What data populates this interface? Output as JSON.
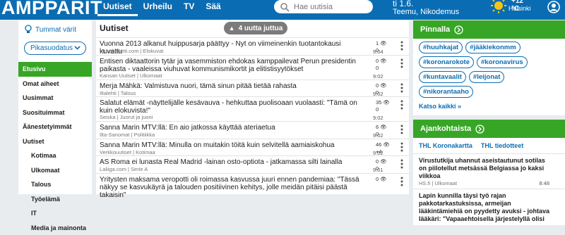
{
  "header": {
    "logo": "AMPPARIT",
    "nav": [
      "Uutiset",
      "Urheilu",
      "TV",
      "Sää"
    ],
    "search_placeholder": "Hae uutisia",
    "date": "ti 1.6.",
    "names": "Teemu, Nikodemus",
    "temp": "+12 °C",
    "city": "Helsinki"
  },
  "sidebar": {
    "tips": "Tummat värit",
    "quick_filter": "Pikasuodatus",
    "items": [
      {
        "label": "Etusivu",
        "active": true,
        "sub": false
      },
      {
        "label": "Omat aiheet",
        "active": false,
        "sub": false
      },
      {
        "label": "Uusimmat",
        "active": false,
        "sub": false
      },
      {
        "label": "Suosituimmat",
        "active": false,
        "sub": false
      },
      {
        "label": "Äänestetyimmät",
        "active": false,
        "sub": false
      },
      {
        "label": "Uutiset",
        "active": false,
        "sub": false
      },
      {
        "label": "Kotimaa",
        "active": false,
        "sub": true
      },
      {
        "label": "Ulkomaat",
        "active": false,
        "sub": true
      },
      {
        "label": "Talous",
        "active": false,
        "sub": true
      },
      {
        "label": "Työelämä",
        "active": false,
        "sub": true
      },
      {
        "label": "IT",
        "active": false,
        "sub": true
      },
      {
        "label": "Media ja mainonta",
        "active": false,
        "sub": true
      }
    ]
  },
  "main": {
    "title": "Uutiset",
    "new_items": "4 uutta juttua",
    "articles": [
      {
        "title": "Vuonna 2013 alkanut huippusarja päättyy - Nyt on viimeinenkin tuotantokausi kuvattu",
        "source": "Muropaketti.com | Elokuvat",
        "time": "9:04",
        "c1": "1",
        "c2": "0",
        "two": false
      },
      {
        "title": "Entisen diktaattorin tytär ja vasemmiston ehdokas kamppailevat Perun presidentin paikasta - vaaleissa viuhuvat kommunismikortit ja elitistisyytökset",
        "source": "Kansan Uutiset | Ulkomaat",
        "time": "9:02",
        "c1": "0",
        "c2": "0",
        "two": true
      },
      {
        "title": "Merja Mähkä: Valmistuva nuori, tämä sinun pitää tietää rahasta",
        "source": "Iltalehti | Talous",
        "time": "9:02",
        "c1": "0",
        "c2": "0",
        "two": false
      },
      {
        "title": "Salatut elämät -näyttelijälle kesävauva - hehkuttaa puolisoaan vuolaasti: \"Tämä on kuin elokuvista!\"",
        "source": "Seiska | Juorut ja juoni",
        "time": "9:02",
        "c1": "35",
        "c2": "0",
        "two": true
      },
      {
        "title": "Sanna Marin MTV:llä: En aio jatkossa käyttää ateriaetua",
        "source": "Ilta-Sanomat | Politiikka",
        "time": "9:02",
        "c1": "6",
        "c2": "0",
        "two": false
      },
      {
        "title": "Sanna Marin MTV:llä: Minulla on muitakin töitä kuin selvitellä aamiaiskohua",
        "source": "Verkkouutiset | Kotimaa",
        "time": "9:02",
        "c1": "46",
        "c2": "+4",
        "two": false
      },
      {
        "title": "AS Roma ei lunasta Real Madrid -lainan osto-optiota - jatkamassa silti lainalla",
        "source": "Laliiga.com | Serie A",
        "time": "9:01",
        "c1": "0",
        "c2": "0",
        "two": false
      },
      {
        "title": "Yritysten maksama veropotti oli roimassa kasvussa juuri ennen pandemiaa: \"Tässä näkyy se kasvukäyrä ja talouden positiivinen kehitys, jolle meidän pitäisi päästä takaisin\"",
        "source": "",
        "time": "",
        "c1": "0",
        "c2": "",
        "two": true
      }
    ]
  },
  "pinnalla": {
    "title": "Pinnalla",
    "tags": [
      "#huuhkajat",
      "#jääkiekonmm",
      "#koronarokote",
      "#koronavirus",
      "#kuntavaalit",
      "#leijonat",
      "#nikorantaaho"
    ],
    "see_all": "Katso kaikki »"
  },
  "ajankohtaista": {
    "title": "Ajankohtaista",
    "links": [
      "THL Koronakartta",
      "THL tiedotteet"
    ],
    "news": [
      {
        "title": "Virustutkija uhannut aseistautunut sotilas on piilotellut metsässä Belgiassa jo kaksi viikkoa",
        "source": "HS.fi | Ulkomaat",
        "time": "8:48"
      },
      {
        "title": "Lapin kunnilla täysi työ rajan pakkotarkastuksissa, armeijan lääkintämiehiä on pyydetty avuksi - johtava lääkäri: \"Vapaaehtoisella järjestelyllä olisi",
        "source": "",
        "time": ""
      }
    ]
  },
  "colors": {
    "header": "#0a6db3",
    "accent": "#37a626"
  }
}
